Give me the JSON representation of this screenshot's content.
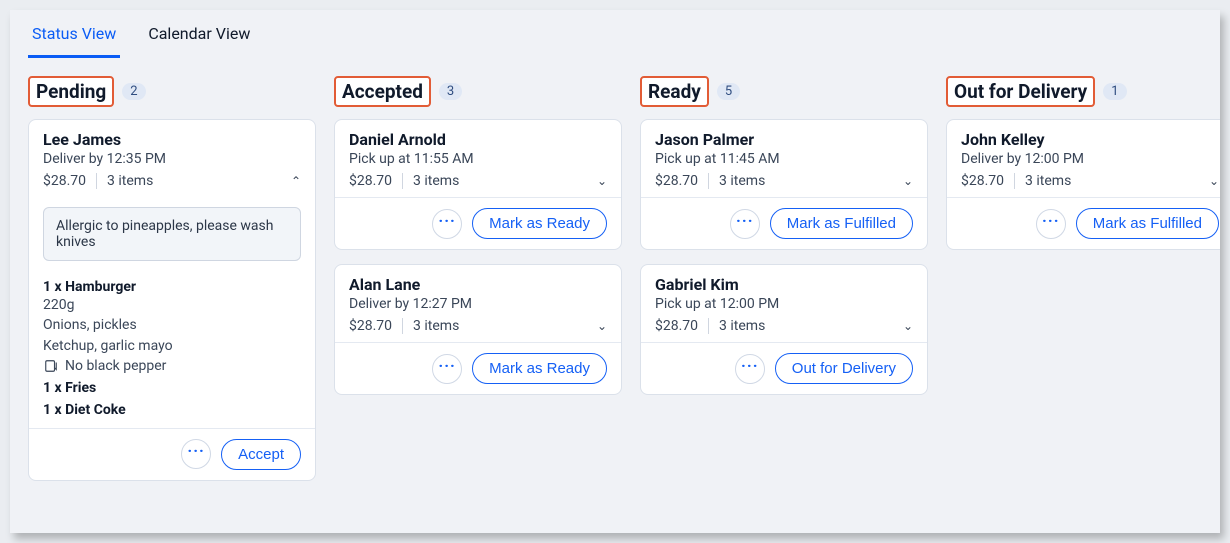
{
  "tabs": {
    "status": "Status View",
    "calendar": "Calendar View"
  },
  "columns": [
    {
      "title": "Pending",
      "count": "2"
    },
    {
      "title": "Accepted",
      "count": "3"
    },
    {
      "title": "Ready",
      "count": "5"
    },
    {
      "title": "Out for Delivery",
      "count": "1"
    }
  ],
  "pending": {
    "card0": {
      "customer": "Lee James",
      "due": "Deliver by 12:35 PM",
      "price": "$28.70",
      "items_count": "3 items",
      "note": "Allergic to pineapples, please wash knives",
      "line0_title": "1 x Hamburger",
      "line0_d0": "220g",
      "line0_d1": "Onions, pickles",
      "line0_d2": "Ketchup, garlic mayo",
      "line0_mod": "No black pepper",
      "line1_title": "1 x Fries",
      "line2_title": "1 x Diet Coke",
      "action": "Accept"
    }
  },
  "accepted": {
    "card0": {
      "customer": "Daniel Arnold",
      "due": "Pick up at 11:55 AM",
      "price": "$28.70",
      "items_count": "3 items",
      "action": "Mark as Ready"
    },
    "card1": {
      "customer": "Alan Lane",
      "due": "Deliver by 12:27 PM",
      "price": "$28.70",
      "items_count": "3 items",
      "action": "Mark as Ready"
    }
  },
  "ready": {
    "card0": {
      "customer": "Jason Palmer",
      "due": "Pick up at 11:45 AM",
      "price": "$28.70",
      "items_count": "3 items",
      "action": "Mark as Fulfilled"
    },
    "card1": {
      "customer": "Gabriel Kim",
      "due": "Pick up at 12:00 PM",
      "price": "$28.70",
      "items_count": "3 items",
      "action": "Out for Delivery"
    }
  },
  "out": {
    "card0": {
      "customer": "John Kelley",
      "due": "Deliver by 12:00 PM",
      "price": "$28.70",
      "items_count": "3 items",
      "action": "Mark as Fulfilled"
    }
  }
}
